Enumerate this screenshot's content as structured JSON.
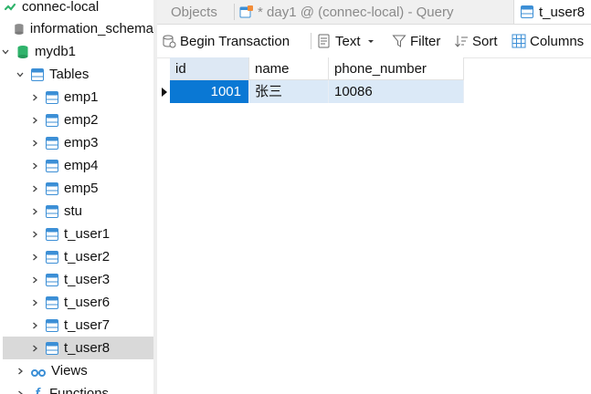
{
  "sidebar": {
    "connection": "connec-local",
    "databases": [
      "information_schema",
      "mydb1"
    ],
    "tables_label": "Tables",
    "tables": [
      "emp1",
      "emp2",
      "emp3",
      "emp4",
      "emp5",
      "stu",
      "t_user1",
      "t_user2",
      "t_user3",
      "t_user6",
      "t_user7",
      "t_user8"
    ],
    "selected_table": "t_user8",
    "views_label": "Views",
    "functions_label": "Functions"
  },
  "tabs": [
    {
      "label": "Objects",
      "active": false
    },
    {
      "label": "* day1 @ (connec-local) - Query",
      "active": false
    },
    {
      "label": "t_user8",
      "active": true
    }
  ],
  "toolbar": {
    "begin_transaction": "Begin Transaction",
    "text": "Text",
    "filter": "Filter",
    "sort": "Sort",
    "columns": "Columns"
  },
  "grid": {
    "columns": [
      "id",
      "name",
      "phone_number"
    ],
    "rows": [
      [
        "1001",
        "张三",
        "10086"
      ]
    ]
  },
  "colors": {
    "accent": "#0a78d4",
    "row_highlight": "#dbe9f7",
    "table_icon": "#3c8fd6",
    "db_icon": "#2fb36b"
  }
}
